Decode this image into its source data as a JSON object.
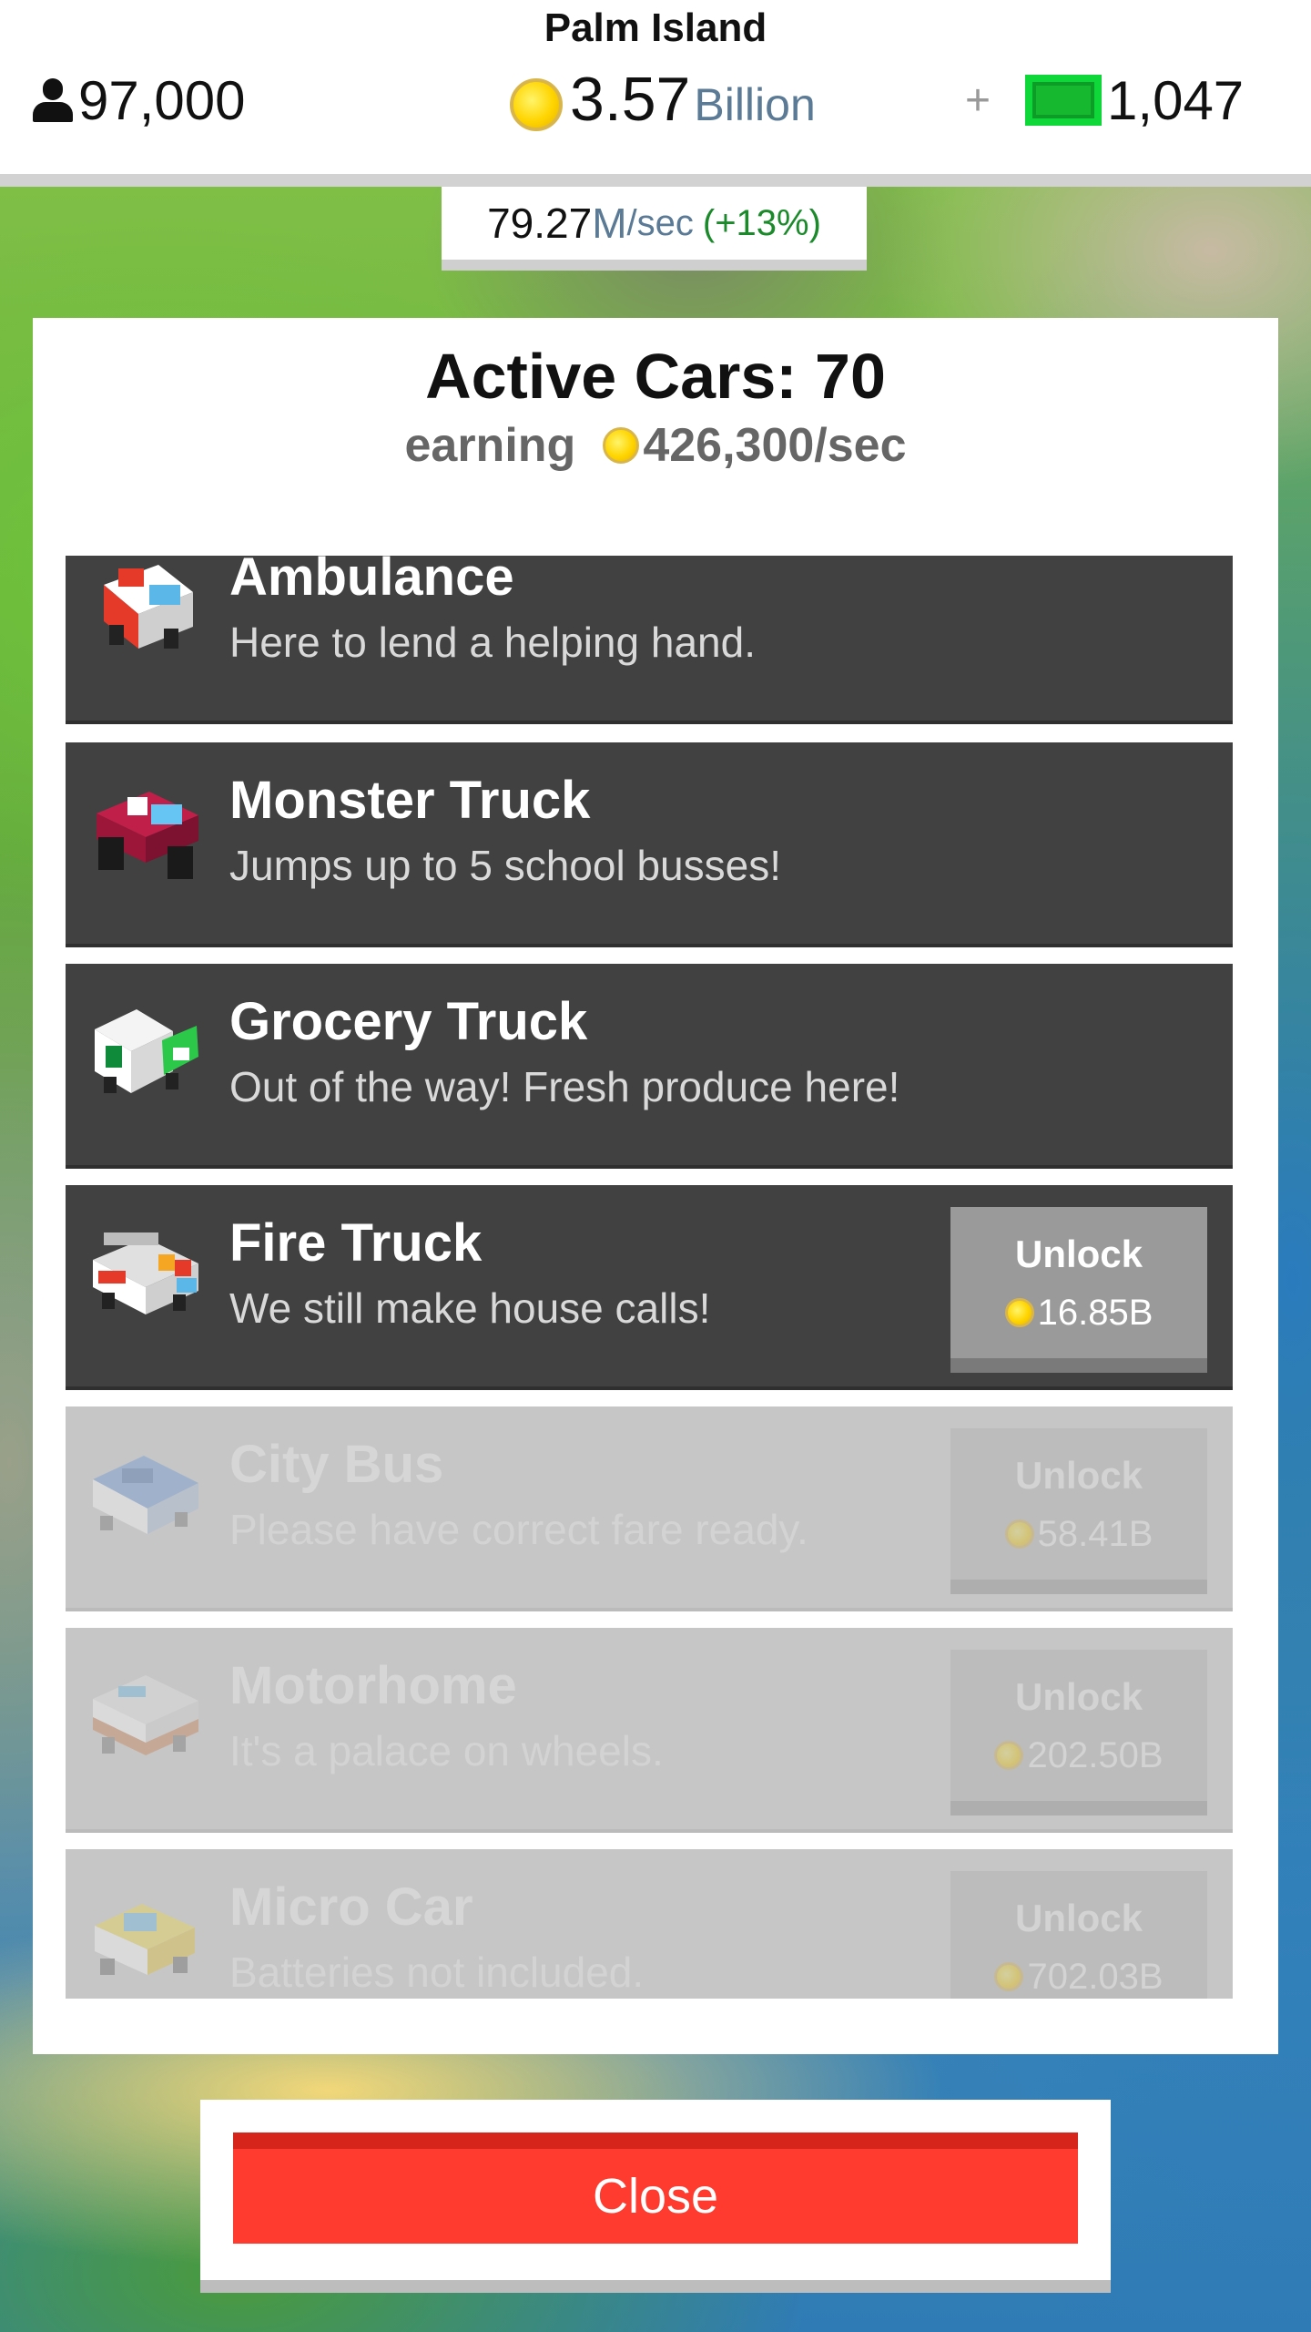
{
  "hud": {
    "island_name": "Palm Island",
    "population": "97,000",
    "cash_amount": "3.57",
    "cash_unit": "Billion",
    "gems": "1,047",
    "plus_label": "+",
    "rate_value": "79.27",
    "rate_unit": "M",
    "rate_per": "/sec",
    "rate_bonus": "(+13%)"
  },
  "modal": {
    "title": "Active Cars: 70",
    "earning_label": "earning",
    "earning_value": "426,300/sec"
  },
  "cars": [
    {
      "name": "Ambulance",
      "desc": "Here to lend a helping hand.",
      "state": "owned",
      "icon": "ambulance-icon"
    },
    {
      "name": "Monster Truck",
      "desc": "Jumps up to 5 school busses!",
      "state": "owned",
      "icon": "monster-truck-icon"
    },
    {
      "name": "Grocery Truck",
      "desc": "Out of the way! Fresh produce here!",
      "state": "owned",
      "icon": "grocery-truck-icon"
    },
    {
      "name": "Fire Truck",
      "desc": "We still make house calls!",
      "state": "unlockable",
      "unlock_label": "Unlock",
      "price": "16.85B",
      "icon": "fire-truck-icon"
    },
    {
      "name": "City Bus",
      "desc": "Please have correct fare ready.",
      "state": "locked",
      "unlock_label": "Unlock",
      "price": "58.41B",
      "icon": "city-bus-icon"
    },
    {
      "name": "Motorhome",
      "desc": "It's a palace on wheels.",
      "state": "locked",
      "unlock_label": "Unlock",
      "price": "202.50B",
      "icon": "motorhome-icon"
    },
    {
      "name": "Micro Car",
      "desc": "Batteries not included.",
      "state": "locked",
      "unlock_label": "Unlock",
      "price": "702.03B",
      "icon": "micro-car-icon"
    }
  ],
  "close_label": "Close",
  "colors": {
    "close_button": "#ff3b2f",
    "row_owned": "#414141",
    "row_locked": "#c6c6c6",
    "gem": "#16b830",
    "coin": "#ffd500",
    "rate_bonus": "#1a8a2a"
  }
}
